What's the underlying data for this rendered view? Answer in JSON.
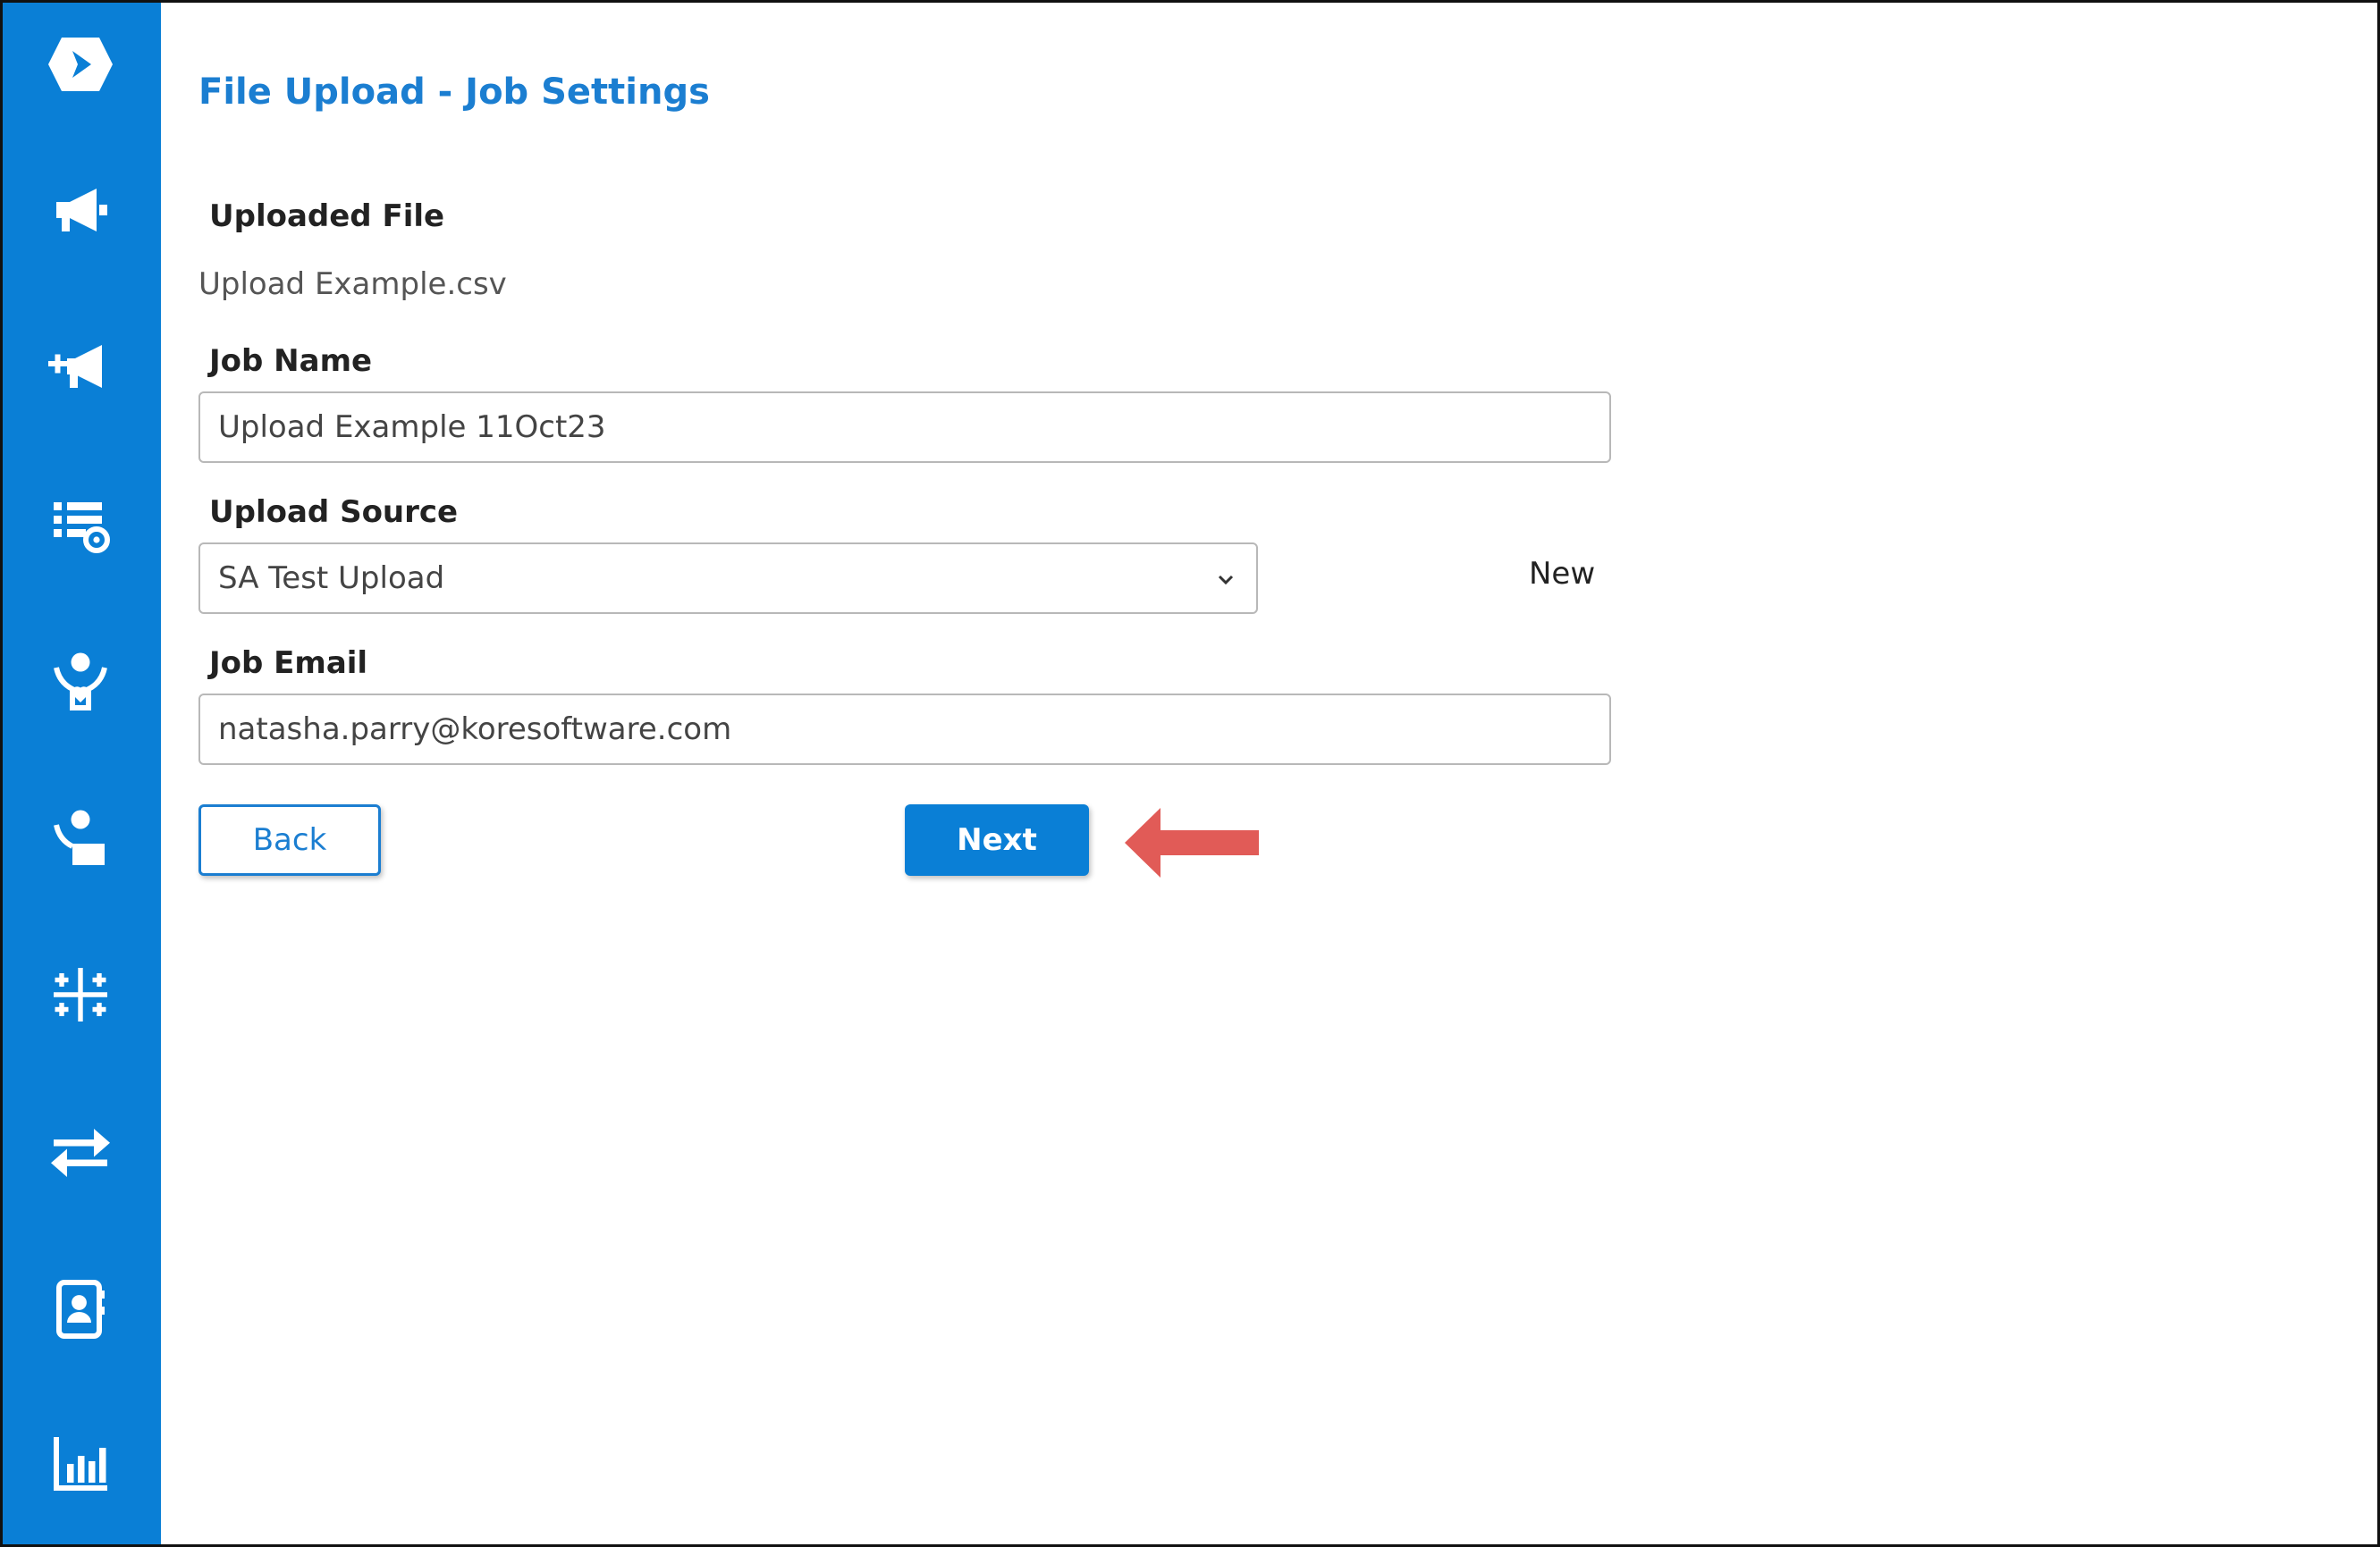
{
  "sidebar": {
    "icons": [
      "logo-icon",
      "megaphone-icon",
      "megaphone-add-icon",
      "list-settings-icon",
      "person-heart-icon",
      "person-card-icon",
      "sparkle-grid-icon",
      "transfer-arrows-icon",
      "contact-book-icon",
      "bar-chart-icon"
    ]
  },
  "page": {
    "title": "File Upload - Job Settings"
  },
  "form": {
    "uploaded_file_label": "Uploaded File",
    "uploaded_file_value": "Upload Example.csv",
    "job_name_label": "Job Name",
    "job_name_value": "Upload Example 11Oct23",
    "upload_source_label": "Upload Source",
    "upload_source_value": "SA Test Upload",
    "new_link": "New",
    "job_email_label": "Job Email",
    "job_email_value": "natasha.parry@koresoftware.com"
  },
  "buttons": {
    "back": "Back",
    "next": "Next"
  },
  "colors": {
    "sidebar_bg": "#0a7fd6",
    "accent": "#1b7ed1",
    "annotation_arrow": "#e15b57"
  }
}
